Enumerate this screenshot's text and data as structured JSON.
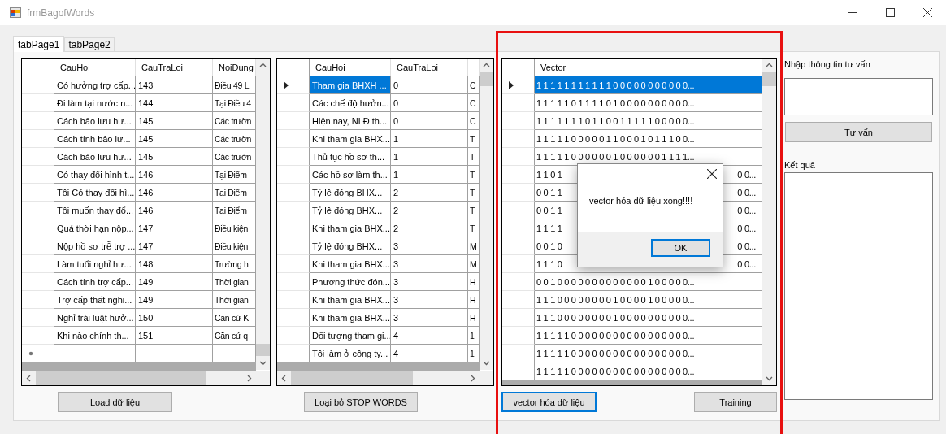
{
  "window": {
    "title": "frmBagofWords"
  },
  "tabs": [
    {
      "label": "tabPage1",
      "selected": true
    },
    {
      "label": "tabPage2",
      "selected": false
    }
  ],
  "grids": [
    {
      "columns": [
        "CauHoi",
        "CauTraLoi",
        "NoiDung"
      ],
      "new_row": true,
      "buttons": [
        {
          "label": "Load dữ liệu",
          "focused": false
        }
      ],
      "rows": [
        {
          "selected": false,
          "cells": [
            "Có hưởng trợ cấp...",
            "143",
            "Điều 49 L"
          ]
        },
        {
          "selected": false,
          "cells": [
            "Đi làm tại nước n...",
            "144",
            "Tại Điều 4"
          ]
        },
        {
          "selected": false,
          "cells": [
            "Cách bảo lưu hư...",
            "145",
            "Các trườn"
          ]
        },
        {
          "selected": false,
          "cells": [
            "Cách tính bảo lư...",
            "145",
            "Các trườn"
          ]
        },
        {
          "selected": false,
          "cells": [
            "Cách bảo lưu hư...",
            "145",
            "Các trườn"
          ]
        },
        {
          "selected": false,
          "cells": [
            "Có thay đổi hình t...",
            "146",
            "Tại Điểm"
          ]
        },
        {
          "selected": false,
          "cells": [
            "Tôi Có thay đổi hì...",
            "146",
            "Tại Điểm"
          ]
        },
        {
          "selected": false,
          "cells": [
            "Tôi muốn thay đổ...",
            "146",
            "Tại Điểm"
          ]
        },
        {
          "selected": false,
          "cells": [
            "Quá thời hạn nộp...",
            "147",
            "Điều kiện"
          ]
        },
        {
          "selected": false,
          "cells": [
            "Nộp hồ sơ trễ trợ ...",
            "147",
            "Điều kiện"
          ]
        },
        {
          "selected": false,
          "cells": [
            "Làm tuổi nghỉ hư...",
            "148",
            "Trường h"
          ]
        },
        {
          "selected": false,
          "cells": [
            "Cách tính trợ cấp...",
            "149",
            "Thời gian"
          ]
        },
        {
          "selected": false,
          "cells": [
            "Trợ cấp thất nghi...",
            "149",
            "Thời gian"
          ]
        },
        {
          "selected": false,
          "cells": [
            "Nghỉ trái luật hưở...",
            "150",
            "Căn cứ K"
          ]
        },
        {
          "selected": false,
          "cells": [
            "Khi nào chính th...",
            "151",
            "Căn cứ q"
          ]
        }
      ]
    },
    {
      "columns": [
        "CauHoi",
        "CauTraLoi"
      ],
      "new_row": false,
      "buttons": [
        {
          "label": "Loại bỏ STOP WORDS",
          "focused": false
        }
      ],
      "rows": [
        {
          "selected": true,
          "cells": [
            "Tham gia BHXH ...",
            "0",
            "C"
          ]
        },
        {
          "selected": false,
          "cells": [
            "Các chế độ hưởn...",
            "0",
            "C"
          ]
        },
        {
          "selected": false,
          "cells": [
            "Hiện nay, NLĐ th...",
            "0",
            "C"
          ]
        },
        {
          "selected": false,
          "cells": [
            "Khi tham gia BHX...",
            "1",
            "T"
          ]
        },
        {
          "selected": false,
          "cells": [
            "Thủ tục hồ sơ th...",
            "1",
            "T"
          ]
        },
        {
          "selected": false,
          "cells": [
            "Các hồ sơ làm th...",
            "1",
            "T"
          ]
        },
        {
          "selected": false,
          "cells": [
            "Tỷ lệ đóng BHX...",
            "2",
            "T"
          ]
        },
        {
          "selected": false,
          "cells": [
            "Tỷ lệ đóng BHX...",
            "2",
            "T"
          ]
        },
        {
          "selected": false,
          "cells": [
            "Khi tham gia BHX...",
            "2",
            "T"
          ]
        },
        {
          "selected": false,
          "cells": [
            "Tỷ lệ đóng BHX...",
            "3",
            "M"
          ]
        },
        {
          "selected": false,
          "cells": [
            "Khi tham gia BHX...",
            "3",
            "M"
          ]
        },
        {
          "selected": false,
          "cells": [
            "Phương thức đón...",
            "3",
            "H"
          ]
        },
        {
          "selected": false,
          "cells": [
            "Khi tham gia BHX...",
            "3",
            "H"
          ]
        },
        {
          "selected": false,
          "cells": [
            "Khi tham gia BHX...",
            "3",
            "H"
          ]
        },
        {
          "selected": false,
          "cells": [
            "Đối tượng tham gi...",
            "4",
            "1"
          ]
        },
        {
          "selected": false,
          "cells": [
            "Tôi làm ở công ty...",
            "4",
            "1"
          ]
        }
      ]
    },
    {
      "columns": [
        "Vector"
      ],
      "new_row": false,
      "buttons": [
        {
          "label": "vector hóa dữ liệu",
          "focused": true
        },
        {
          "label": "Training",
          "focused": false
        }
      ],
      "rows": [
        {
          "selected": true,
          "kind": "full",
          "vector": "1 1 1 1 1 1 1 1 1 1 1 0 0 0 0 0 0 0 0 0 0 0..."
        },
        {
          "selected": false,
          "kind": "full",
          "vector": "1 1 1 1 1 0 1 1 1 1 0 1 0 0 0 0 0 0 0 0 0 0..."
        },
        {
          "selected": false,
          "kind": "full",
          "vector": "1 1 1 1 1 1 1 0 1 1 0 0 1 1 1 1 1 0 0 0 0 0..."
        },
        {
          "selected": false,
          "kind": "full",
          "vector": "1 1 1 1 1 0 0 0 0 0 1 1 0 0 0 1 0 1 1 1 0 0..."
        },
        {
          "selected": false,
          "kind": "full",
          "vector": "1 1 1 1 1 0 0 0 0 0 0 1 0 0 0 0 0 0 1 1 1 1..."
        },
        {
          "selected": false,
          "kind": "covered",
          "start": "1 1 0 1",
          "end": "0 0..."
        },
        {
          "selected": false,
          "kind": "covered",
          "start": "0 0 1 1",
          "end": "0 0..."
        },
        {
          "selected": false,
          "kind": "covered",
          "start": "0 0 1 1",
          "end": "0 0..."
        },
        {
          "selected": false,
          "kind": "covered",
          "start": "1 1 1 1",
          "end": "0 0..."
        },
        {
          "selected": false,
          "kind": "covered",
          "start": "0 0 1 0",
          "end": "0 0..."
        },
        {
          "selected": false,
          "kind": "covered",
          "start": "1 1 1 0",
          "end": "0 0..."
        },
        {
          "selected": false,
          "kind": "full",
          "vector": "0 0 1 0 0 0 0 0 0 0 0 0 0 0 0 0 1 0 0 0 0 0..."
        },
        {
          "selected": false,
          "kind": "full",
          "vector": "1 1 1 0 0 0 0 0 0 0 0 1 0 0 0 0 1 0 0 0 0 0..."
        },
        {
          "selected": false,
          "kind": "full",
          "vector": "1 1 1 0 0 0 0 0 0 0 0 1 0 0 0 0 0 0 0 0 0 0..."
        },
        {
          "selected": false,
          "kind": "full",
          "vector": "1 1 1 1 1 0 0 0 0 0 0 0 0 0 0 0 0 0 0 0 0 0..."
        },
        {
          "selected": false,
          "kind": "full",
          "vector": "1 1 1 1 1 0 0 0 0 0 0 0 0 0 0 0 0 0 0 0 0 0..."
        },
        {
          "selected": false,
          "kind": "full",
          "vector": "1 1 1 1 1 0 0 0 0 0 0 0 0 0 0 0 0 0 0 0 0 0..."
        }
      ]
    }
  ],
  "consult": {
    "input_label": "Nhập thông tin tư vấn",
    "button": "Tư vấn",
    "result_label": "Kết quả"
  },
  "dialog": {
    "message": "vector hóa dữ liệu xong!!!!",
    "buttons": [
      {
        "label": "OK",
        "focused": true
      }
    ]
  },
  "annotations": [
    {
      "kind": "frame"
    }
  ]
}
